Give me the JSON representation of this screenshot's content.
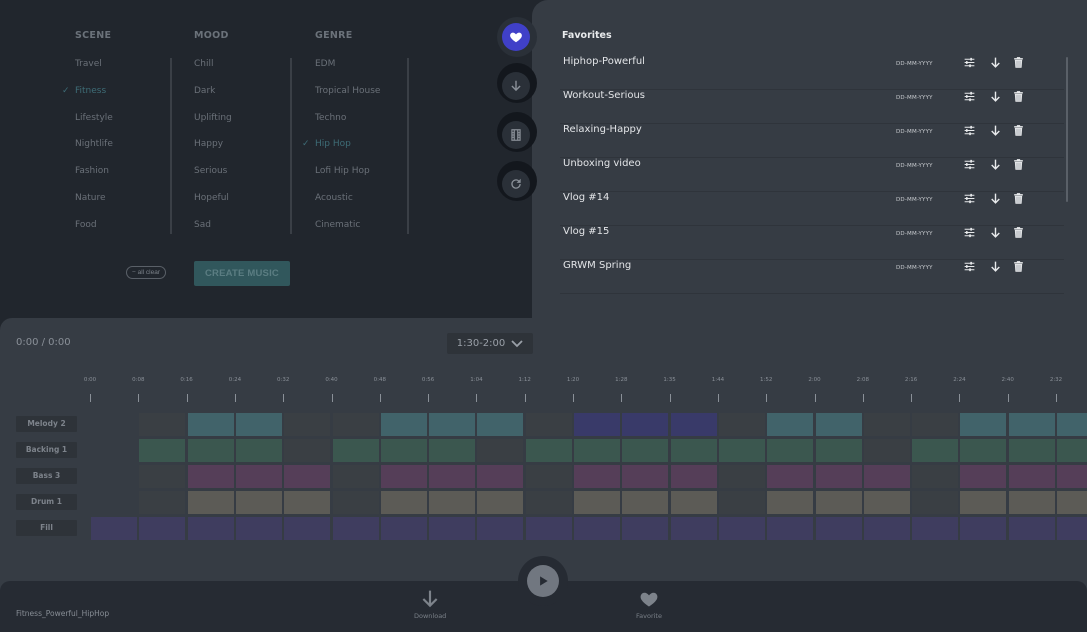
{
  "filters": {
    "columns": [
      {
        "heading": "SCENE",
        "items": [
          "Travel",
          "Fitness",
          "Lifestyle",
          "Nightlife",
          "Fashion",
          "Nature",
          "Food"
        ],
        "selected": "Fitness"
      },
      {
        "heading": "MOOD",
        "items": [
          "Chill",
          "Dark",
          "Uplifting",
          "Happy",
          "Serious",
          "Hopeful",
          "Sad"
        ],
        "selected": null
      },
      {
        "heading": "GENRE",
        "items": [
          "EDM",
          "Tropical House",
          "Techno",
          "Hip Hop",
          "Lofi Hip Hop",
          "Acoustic",
          "Cinematic"
        ],
        "selected": "Hip Hop"
      }
    ],
    "check_glyph": "✓",
    "clear_label": "− all clear",
    "create_label": "CREATE MUSIC"
  },
  "rail": {
    "buttons": [
      {
        "icon": "heart-icon",
        "active": true
      },
      {
        "icon": "download-icon",
        "active": false
      },
      {
        "icon": "film-icon",
        "active": false
      },
      {
        "icon": "refresh-icon",
        "active": false
      }
    ]
  },
  "favorites": {
    "title": "Favorites",
    "items": [
      {
        "name": "Hiphop-Powerful",
        "date": "DD-MM-YYYY"
      },
      {
        "name": "Workout-Serious",
        "date": "DD-MM-YYYY"
      },
      {
        "name": "Relaxing-Happy",
        "date": "DD-MM-YYYY"
      },
      {
        "name": "Unboxing video",
        "date": "DD-MM-YYYY"
      },
      {
        "name": "Vlog #14",
        "date": "DD-MM-YYYY"
      },
      {
        "name": "Vlog #15",
        "date": "DD-MM-YYYY"
      },
      {
        "name": "GRWM Spring",
        "date": "DD-MM-YYYY"
      }
    ],
    "row_icons": [
      "sliders-icon",
      "download-icon",
      "trash-icon"
    ]
  },
  "player": {
    "time": "0:00 / 0:00",
    "range": "1:30-2:00",
    "ticks": [
      "0:00",
      "0:08",
      "0:16",
      "0:24",
      "0:32",
      "0:40",
      "0:48",
      "0:56",
      "1:04",
      "1:12",
      "1:20",
      "1:28",
      "1:35",
      "1:44",
      "1:52",
      "2:00",
      "2:08",
      "2:16",
      "2:24",
      "2:40",
      "2:32"
    ],
    "colors": {
      "empty": "#3a3f44",
      "teal": "#41636a",
      "green": "#3b574f",
      "blue": "#393a69",
      "purple": "#553e58",
      "gray": "#5c5b56",
      "indigo": "#3f3d5f"
    },
    "tracks": [
      {
        "name": "Melody 2",
        "cells": [
          "none",
          "empty",
          "teal",
          "teal",
          "empty",
          "empty",
          "teal",
          "teal",
          "teal",
          "empty",
          "blue",
          "blue",
          "blue",
          "empty",
          "teal",
          "teal",
          "empty",
          "empty",
          "teal",
          "teal",
          "teal"
        ]
      },
      {
        "name": "Backing 1",
        "cells": [
          "none",
          "green",
          "green",
          "green",
          "empty",
          "green",
          "green",
          "green",
          "empty",
          "green",
          "green",
          "green",
          "green",
          "green",
          "green",
          "green",
          "empty",
          "green",
          "green",
          "green",
          "green"
        ]
      },
      {
        "name": "Bass 3",
        "cells": [
          "none",
          "empty",
          "purple",
          "purple",
          "purple",
          "empty",
          "purple",
          "purple",
          "purple",
          "empty",
          "purple",
          "purple",
          "purple",
          "empty",
          "purple",
          "purple",
          "purple",
          "empty",
          "purple",
          "purple",
          "purple"
        ]
      },
      {
        "name": "Drum 1",
        "cells": [
          "none",
          "empty",
          "gray",
          "gray",
          "gray",
          "empty",
          "gray",
          "gray",
          "gray",
          "empty",
          "gray",
          "gray",
          "gray",
          "empty",
          "gray",
          "gray",
          "gray",
          "empty",
          "gray",
          "gray",
          "gray"
        ]
      },
      {
        "name": "Fill",
        "cells": [
          "indigo",
          "indigo",
          "indigo",
          "indigo",
          "indigo",
          "indigo",
          "indigo",
          "indigo",
          "indigo",
          "indigo",
          "indigo",
          "indigo",
          "indigo",
          "indigo",
          "indigo",
          "indigo",
          "indigo",
          "indigo",
          "indigo",
          "indigo",
          "indigo"
        ]
      }
    ]
  },
  "bottom_bar": {
    "track_name": "Fitness_Powerful_HipHop",
    "download_label": "Download",
    "favorite_label": "Favorite"
  }
}
